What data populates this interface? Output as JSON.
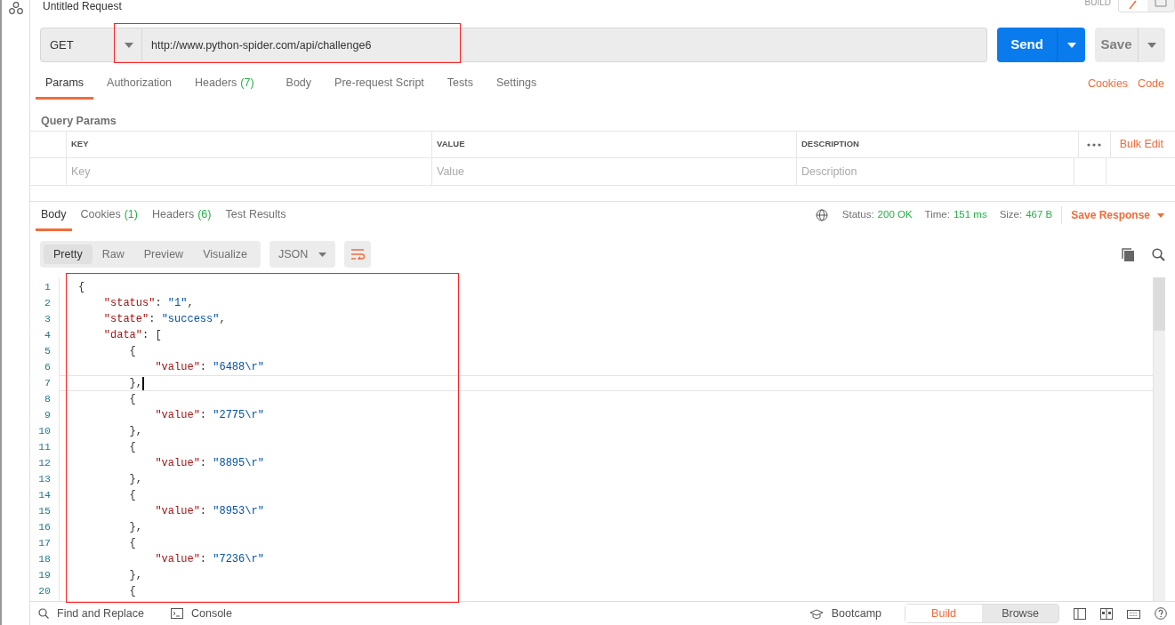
{
  "request": {
    "title": "Untitled Request",
    "mode_label": "BUILD",
    "method": "GET",
    "url": "http://www.python-spider.com/api/challenge6",
    "send_label": "Send",
    "save_label": "Save"
  },
  "request_tabs": [
    {
      "label": "Params",
      "selected": true
    },
    {
      "label": "Authorization",
      "selected": false
    },
    {
      "label": "Headers",
      "count": "(7)",
      "selected": false
    },
    {
      "label": "Body",
      "selected": false
    },
    {
      "label": "Pre-request Script",
      "selected": false
    },
    {
      "label": "Tests",
      "selected": false
    },
    {
      "label": "Settings",
      "selected": false
    }
  ],
  "request_links": [
    "Cookies",
    "Code"
  ],
  "params": {
    "title": "Query Params",
    "columns": [
      "KEY",
      "VALUE",
      "DESCRIPTION"
    ],
    "placeholders": [
      "Key",
      "Value",
      "Description"
    ],
    "bulk_edit": "Bulk Edit"
  },
  "response_tabs": [
    {
      "label": "Body",
      "selected": true
    },
    {
      "label": "Cookies",
      "count": "(1)",
      "selected": false
    },
    {
      "label": "Headers",
      "count": "(6)",
      "selected": false
    },
    {
      "label": "Test Results",
      "selected": false
    }
  ],
  "response_meta": [
    {
      "label": "Status:",
      "value": "200 OK"
    },
    {
      "label": "Time:",
      "value": "151 ms"
    },
    {
      "label": "Size:",
      "value": "467 B"
    }
  ],
  "save_response": "Save Response",
  "view_modes": [
    {
      "label": "Pretty",
      "selected": true
    },
    {
      "label": "Raw",
      "selected": false
    },
    {
      "label": "Preview",
      "selected": false
    },
    {
      "label": "Visualize",
      "selected": false
    }
  ],
  "format": "JSON",
  "code_lines": [
    {
      "number": "1",
      "text": "{",
      "current": false
    },
    {
      "number": "2",
      "text": "    \"status\": \"1\",",
      "current": false
    },
    {
      "number": "3",
      "text": "    \"state\": \"success\",",
      "current": false
    },
    {
      "number": "4",
      "text": "    \"data\": [",
      "current": false
    },
    {
      "number": "5",
      "text": "        {",
      "current": false
    },
    {
      "number": "6",
      "text": "            \"value\": \"6488\\r\"",
      "current": false
    },
    {
      "number": "7",
      "text": "        },",
      "current": true
    },
    {
      "number": "8",
      "text": "        {",
      "current": false
    },
    {
      "number": "9",
      "text": "            \"value\": \"2775\\r\"",
      "current": false
    },
    {
      "number": "10",
      "text": "        },",
      "current": false
    },
    {
      "number": "11",
      "text": "        {",
      "current": false
    },
    {
      "number": "12",
      "text": "            \"value\": \"8895\\r\"",
      "current": false
    },
    {
      "number": "13",
      "text": "        },",
      "current": false
    },
    {
      "number": "14",
      "text": "        {",
      "current": false
    },
    {
      "number": "15",
      "text": "            \"value\": \"8953\\r\"",
      "current": false
    },
    {
      "number": "16",
      "text": "        },",
      "current": false
    },
    {
      "number": "17",
      "text": "        {",
      "current": false
    },
    {
      "number": "18",
      "text": "            \"value\": \"7236\\r\"",
      "current": false
    },
    {
      "number": "19",
      "text": "        },",
      "current": false
    },
    {
      "number": "20",
      "text": "        {",
      "current": false
    }
  ],
  "status_bar": {
    "left": [
      "Find and Replace",
      "Console"
    ],
    "bootcamp": "Bootcamp",
    "modes": [
      {
        "label": "Build",
        "selected": true
      },
      {
        "label": "Browse",
        "selected": false
      }
    ]
  }
}
